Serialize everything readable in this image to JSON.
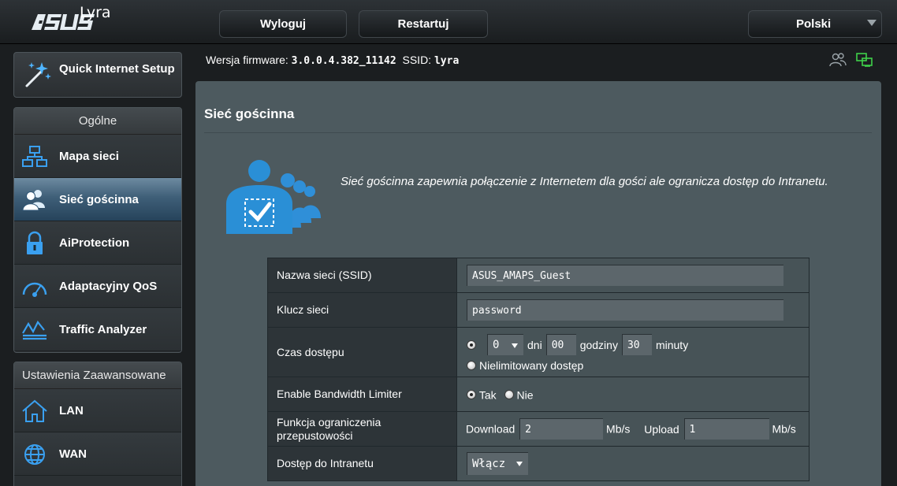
{
  "header": {
    "brand": "/ISUS",
    "product": "Lyra",
    "logout_label": "Wyloguj",
    "restart_label": "Restartuj",
    "language": "Polski"
  },
  "status": {
    "firmware_label": "Wersja firmware:",
    "firmware_value": "3.0.0.4.382_11142",
    "ssid_label": "SSID:",
    "ssid_value": "lyra"
  },
  "sidebar": {
    "qis_label": "Quick Internet Setup",
    "general_header": "Ogólne",
    "general_items": [
      {
        "label": "Mapa sieci",
        "icon": "network-map-icon"
      },
      {
        "label": "Sieć gościnna",
        "icon": "guest-network-icon",
        "active": true
      },
      {
        "label": "AiProtection",
        "icon": "lock-icon"
      },
      {
        "label": "Adaptacyjny QoS",
        "icon": "speedometer-icon"
      },
      {
        "label": "Traffic Analyzer",
        "icon": "traffic-chart-icon"
      }
    ],
    "advanced_header": "Ustawienia Zaawansowane",
    "advanced_items": [
      {
        "label": "LAN",
        "icon": "home-icon"
      },
      {
        "label": "WAN",
        "icon": "globe-icon"
      }
    ]
  },
  "main": {
    "title": "Sieć gościnna",
    "description": "Sieć gościnna zapewnia połączenie z Internetem dla gości ale ogranicza dostęp do Intranetu.",
    "form": {
      "ssid_label": "Nazwa sieci (SSID)",
      "ssid_value": "ASUS_AMAPS_Guest",
      "key_label": "Klucz sieci",
      "key_value": "password",
      "access_time_label": "Czas dostępu",
      "days_value": "0",
      "days_unit": "dni",
      "hours_value": "00",
      "hours_unit": "godziny",
      "minutes_value": "30",
      "minutes_unit": "minuty",
      "unlimited_label": "Nielimitowany dostęp",
      "bandwidth_label": "Enable Bandwidth Limiter",
      "yes_label": "Tak",
      "no_label": "Nie",
      "throughput_label": "Funkcja ograniczenia przepustowości",
      "download_label": "Download",
      "download_value": "2",
      "upload_label": "Upload",
      "upload_value": "1",
      "rate_unit": "Mb/s",
      "intranet_label": "Dostęp do Intranetu",
      "intranet_value": "Włącz"
    }
  },
  "colors": {
    "panel": "#4d5a5f",
    "accent_blue": "#2a8fd6",
    "active_item": "#3f5f78",
    "status_green": "#4cd964"
  }
}
